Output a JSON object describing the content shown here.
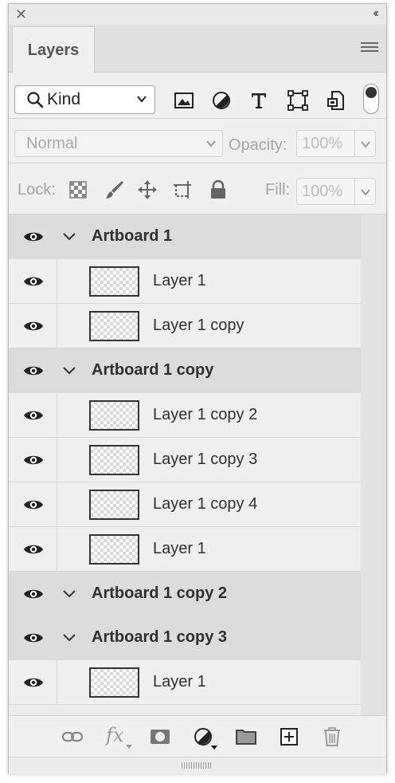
{
  "panel": {
    "tab_label": "Layers",
    "close_glyph": "✕",
    "collapse_glyph": "‹‹"
  },
  "filter": {
    "kind_label": "Kind",
    "icons": [
      "image-filter-icon",
      "adjustment-filter-icon",
      "type-filter-icon",
      "shape-filter-icon",
      "smart-object-filter-icon"
    ],
    "toggle_on": true
  },
  "blend": {
    "mode": "Normal",
    "opacity_label": "Opacity:",
    "opacity_value": "100%"
  },
  "lock": {
    "label": "Lock:",
    "fill_label": "Fill:",
    "fill_value": "100%"
  },
  "layers": [
    {
      "type": "artboard",
      "name": "Artboard 1"
    },
    {
      "type": "layer",
      "name": "Layer 1"
    },
    {
      "type": "layer",
      "name": "Layer 1 copy"
    },
    {
      "type": "artboard",
      "name": "Artboard 1 copy"
    },
    {
      "type": "layer",
      "name": "Layer 1 copy 2"
    },
    {
      "type": "layer",
      "name": "Layer 1 copy 3"
    },
    {
      "type": "layer",
      "name": "Layer 1 copy 4"
    },
    {
      "type": "layer",
      "name": "Layer 1"
    },
    {
      "type": "artboard",
      "name": "Artboard 1 copy 2"
    },
    {
      "type": "artboard",
      "name": "Artboard 1 copy 3"
    },
    {
      "type": "layer",
      "name": "Layer 1"
    }
  ],
  "bottom_toolbar": {
    "fx_label": "fx",
    "icons": [
      "link-layers-icon",
      "fx-icon",
      "layer-mask-icon",
      "adjustment-layer-icon",
      "new-group-folder-icon",
      "new-layer-icon",
      "delete-trash-icon"
    ]
  },
  "colors": {
    "panel_bg": "#f0f0f0",
    "artboard_row_bg": "#dcdcdc",
    "layer_row_bg": "#efefef"
  }
}
